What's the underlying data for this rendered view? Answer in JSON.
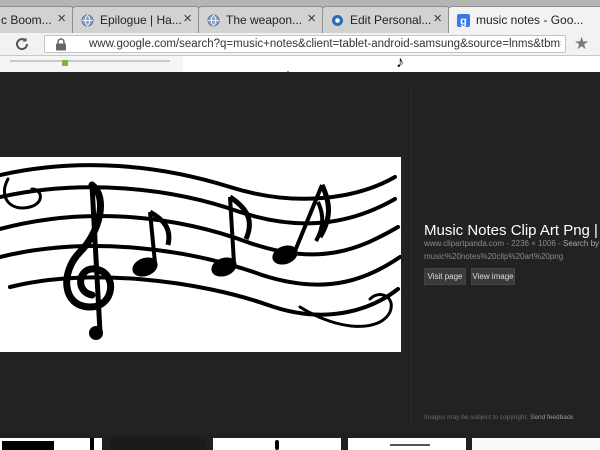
{
  "tabs": [
    {
      "title": "c Boom...",
      "close": "×"
    },
    {
      "title": "Epilogue | Ha...",
      "close": "×"
    },
    {
      "title": "The weapon...",
      "close": "×"
    },
    {
      "title": "Edit Personal...",
      "close": "×"
    },
    {
      "title": "music notes - Goo...",
      "close": "×"
    }
  ],
  "toolbar": {
    "url": "www.google.com/search?q=music+notes&client=tablet-android-samsung&source=lnms&tbm=isch&sa=X&",
    "star_glyph": "★"
  },
  "preview": {
    "title": "Music Notes Clip Art Png | Cli",
    "source": "www.clipartpanda.com",
    "size": "2236 × 1006",
    "search_by": "Search by",
    "filename": "music%20notes%20clip%20art%20png",
    "visit_label": "Visit page",
    "view_label": "View image",
    "copyright": "Images may be subject to copyright.",
    "feedback": "Send feedback"
  },
  "colors": {
    "panel": "#222222",
    "tab_active": "#f2f2f2",
    "tab_inactive": "#d2d2d2"
  }
}
